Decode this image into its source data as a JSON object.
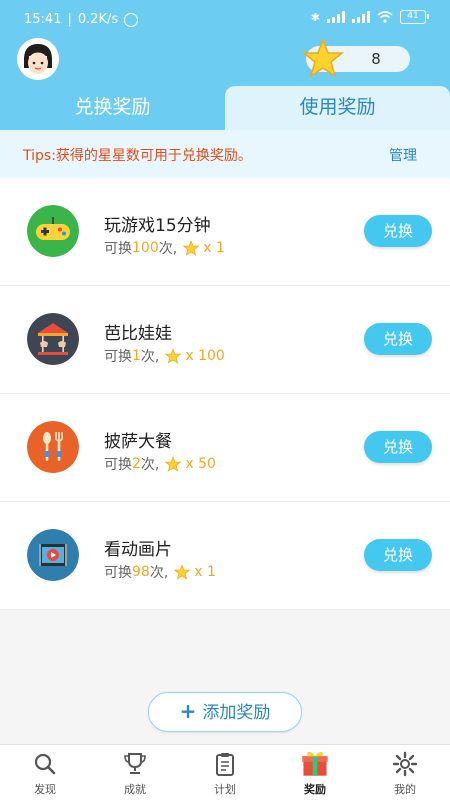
{
  "status_bar": {
    "time": "15:41",
    "speed": "0.2K/s",
    "battery": "41"
  },
  "header": {
    "star_count": "8"
  },
  "tabs": [
    {
      "label": "兑换奖励",
      "active": true
    },
    {
      "label": "使用奖励",
      "active": false
    }
  ],
  "tips": {
    "text": "Tips:获得的星星数可用于兑换奖励。",
    "manage_label": "管理"
  },
  "rewards": [
    {
      "title": "玩游戏15分钟",
      "prefix": "可换",
      "times": "100",
      "times_suffix": "次,",
      "cost": "x 1",
      "button": "兑换",
      "icon": "gamepad-icon",
      "icon_color": "#3ab54a"
    },
    {
      "title": "芭比娃娃",
      "prefix": "可换",
      "times": "1",
      "times_suffix": "次,",
      "cost": "x 100",
      "button": "兑换",
      "icon": "carousel-icon",
      "icon_color": "#3d4652"
    },
    {
      "title": "披萨大餐",
      "prefix": "可换",
      "times": "2",
      "times_suffix": "次,",
      "cost": "x 50",
      "button": "兑换",
      "icon": "utensils-icon",
      "icon_color": "#e8622a"
    },
    {
      "title": "看动画片",
      "prefix": "可换",
      "times": "98",
      "times_suffix": "次,",
      "cost": "x 1",
      "button": "兑换",
      "icon": "video-icon",
      "icon_color": "#2f7fae"
    }
  ],
  "add_button": {
    "label": "添加奖励"
  },
  "bottom_nav": [
    {
      "label": "发现",
      "icon": "search-icon"
    },
    {
      "label": "成就",
      "icon": "trophy-icon"
    },
    {
      "label": "计划",
      "icon": "clipboard-icon"
    },
    {
      "label": "奖励",
      "icon": "gift-icon",
      "active": true
    },
    {
      "label": "我的",
      "icon": "gear-icon"
    }
  ],
  "colors": {
    "header": "#6dccf1",
    "button": "#45c8f0",
    "accent_orange": "#f5a623",
    "tips_red": "#e74c1b"
  }
}
